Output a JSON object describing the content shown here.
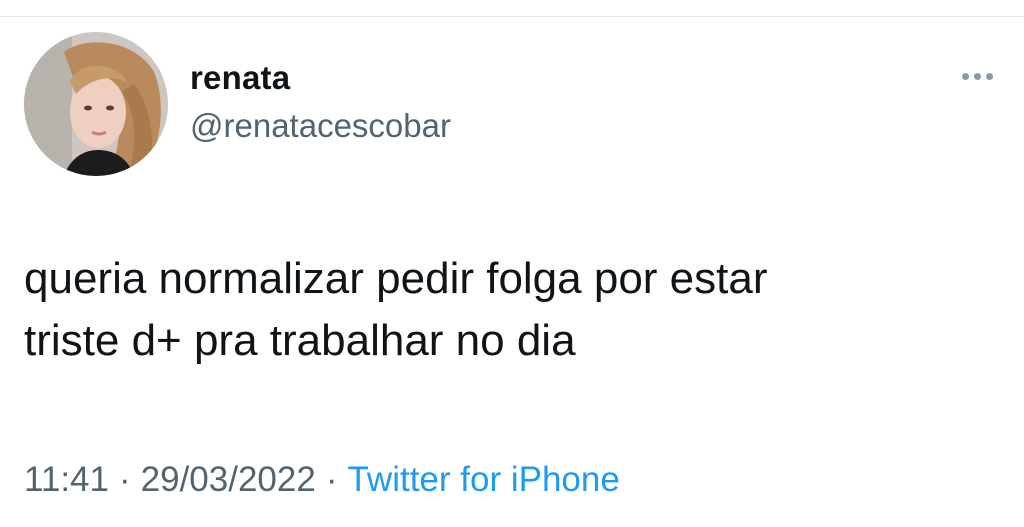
{
  "tweet": {
    "display_name": "renata",
    "handle": "@renatacescobar",
    "text_lines": [
      "queria normalizar pedir folga por estar",
      "triste d+ pra trabalhar no dia"
    ],
    "time": "11:41",
    "date": "29/03/2022",
    "source": "Twitter for iPhone",
    "separator": "·"
  },
  "icons": {
    "avatar": "profile-photo",
    "more": "more-horizontal-icon"
  },
  "colors": {
    "text_primary": "#0f1419",
    "text_secondary": "#536471",
    "link": "#1d9bf0",
    "icon_gray": "#8b98a5"
  }
}
